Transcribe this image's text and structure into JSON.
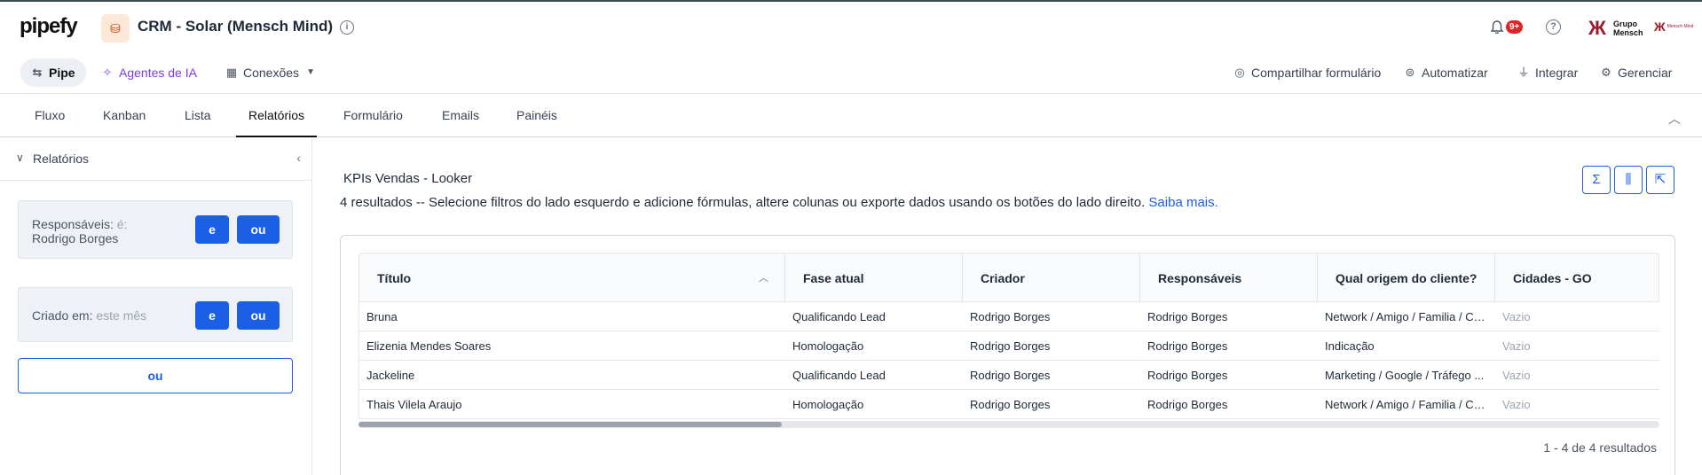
{
  "topbar": {
    "logo": "pipefy",
    "pipe_title": "CRM - Solar (Mensch Mind)",
    "notif_count": "9+",
    "brand_line1": "Grupo",
    "brand_line2": "Mensch",
    "brand2_text": "Mensch Mind"
  },
  "secbar": {
    "pipe_label": "Pipe",
    "ia_label": "Agentes de IA",
    "conexoes_label": "Conexões",
    "share_label": "Compartilhar formulário",
    "automate_label": "Automatizar",
    "integrate_label": "Integrar",
    "manage_label": "Gerenciar"
  },
  "tabs": [
    "Fluxo",
    "Kanban",
    "Lista",
    "Relatórios",
    "Formulário",
    "Emails",
    "Painéis"
  ],
  "sidebar": {
    "title": "Relatórios",
    "filters": [
      {
        "label": "Responsáveis:",
        "operator": "é:",
        "value": "Rodrigo Borges",
        "and": "e",
        "or": "ou"
      },
      {
        "label": "Criado em:",
        "operator": "este mês",
        "value": "",
        "and": "e",
        "or": "ou"
      }
    ],
    "or_button": "ou"
  },
  "report": {
    "title": "KPIs Vendas - Looker",
    "description": "4 resultados -- Selecione filtros do lado esquerdo e adicione fórmulas, altere colunas ou exporte dados usando os botões do lado direito.",
    "learn_more": "Saiba mais.",
    "columns": [
      "Título",
      "Fase atual",
      "Criador",
      "Responsáveis",
      "Qual origem do cliente?",
      "Cidades - GO"
    ],
    "rows": [
      [
        "Bruna",
        "Qualificando Lead",
        "Rodrigo Borges",
        "Rodrigo Borges",
        "Network / Amigo / Familia / Co...",
        "Vazio"
      ],
      [
        "Elizenia Mendes Soares",
        "Homologação",
        "Rodrigo Borges",
        "Rodrigo Borges",
        "Indicação",
        "Vazio"
      ],
      [
        "Jackeline",
        "Qualificando Lead",
        "Rodrigo Borges",
        "Rodrigo Borges",
        "Marketing / Google / Tráfego ...",
        "Vazio"
      ],
      [
        "Thais Vilela Araujo",
        "Homologação",
        "Rodrigo Borges",
        "Rodrigo Borges",
        "Network / Amigo / Familia / Co...",
        "Vazio"
      ]
    ],
    "pagination": "1 - 4 de 4 resultados"
  },
  "colors": {
    "primary": "#1a5fe6",
    "ia": "#7c3aed",
    "badge": "#dc2626",
    "brand": "#9b1c2c"
  }
}
